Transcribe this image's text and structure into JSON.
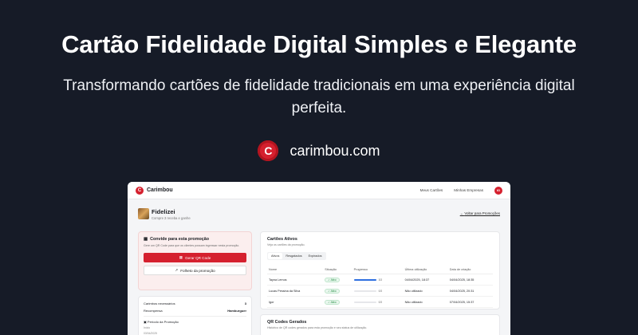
{
  "hero": {
    "title": "Cartão Fidelidade Digital Simples e Elegante",
    "subtitle": "Transformando cartões de fidelidade tradicionais em uma experiência digital perfeita.",
    "brand_domain": "carimbou.com",
    "brand_letter": "C",
    "brand_color": "#d5202e"
  },
  "app": {
    "name": "Carimbou",
    "logo_letter": "C",
    "nav": [
      "Meus Cartões",
      "Minhas Empresas"
    ],
    "avatar": "IG"
  },
  "business": {
    "name": "Fidelizei",
    "rule": "Compre 3 receba e ganhe",
    "back_link": "Voltar para Promoções"
  },
  "invite": {
    "title": "Convide para esta promoção",
    "description": "Gere um QR Code para que os clientes possam ingressar nesta promoção.",
    "generate_button": "Gerar QR Code",
    "flyer_button": "Folheto da promoção"
  },
  "details": {
    "stamps_label": "Carimbos necessários",
    "stamps_value": "3",
    "reward_label": "Recompensa",
    "reward_value": "Hamburguer",
    "period_label": "Período da Promoção",
    "start_label": "Início",
    "start_value": "03/04/2025"
  },
  "cards": {
    "title": "Cartões Ativos",
    "description": "Veja os cartões da promoção.",
    "tabs": [
      "Ativos",
      "Resgatados",
      "Expirados"
    ],
    "columns": [
      "Nome",
      "Situação",
      "Progresso",
      "Última utilização",
      "Data de criação"
    ],
    "rows": [
      {
        "name": "Tayna Lemos",
        "status": "✓ Ativo",
        "progress": 1.0,
        "count": "3/3",
        "last_used": "04/04/2025, 18:37",
        "created": "04/04/2025, 18:35"
      },
      {
        "name": "Lucas Pessina da Silva",
        "status": "✓ Ativo",
        "progress": 0.0,
        "count": "0/3",
        "last_used": "Não utilizado",
        "created": "04/04/2025, 20:31"
      },
      {
        "name": "Igor",
        "status": "✓ Ativo",
        "progress": 0.0,
        "count": "0/3",
        "last_used": "Não utilizado",
        "created": "07/04/2025, 15:37"
      }
    ]
  },
  "qr": {
    "title": "QR Codes Gerados",
    "description": "Histórico de QR codes gerados para esta promoção e seu status de utilização."
  }
}
